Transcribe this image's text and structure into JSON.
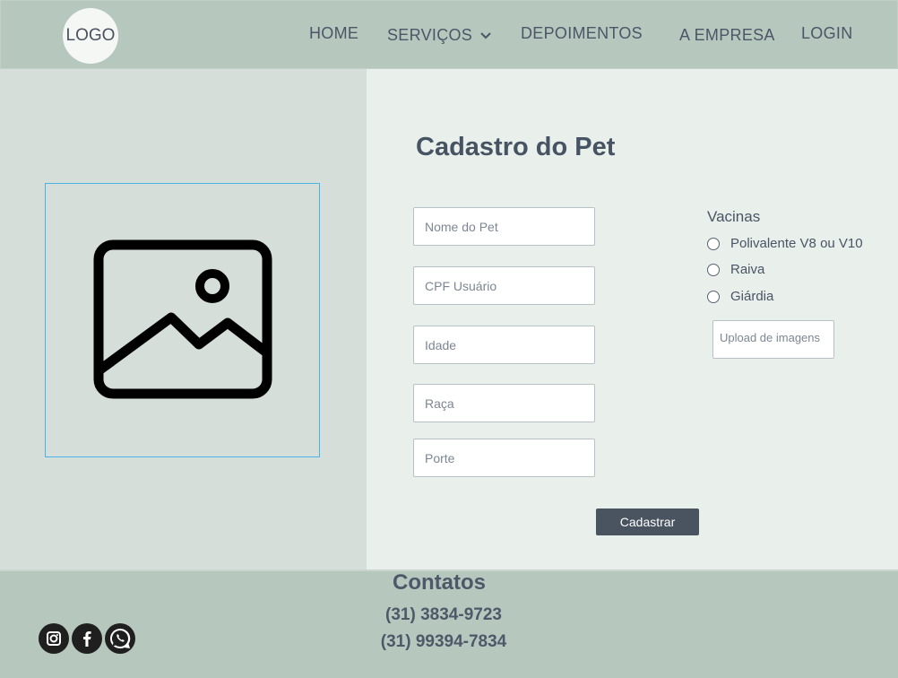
{
  "header": {
    "logo": "LOGO",
    "nav": {
      "home": "HOME",
      "servicos": "SERVIÇOS",
      "depoimentos": "DEPOIMENTOS",
      "empresa": "A EMPRESA",
      "login": "LOGIN"
    }
  },
  "form": {
    "title": "Cadastro do Pet",
    "fields": {
      "nome": "Nome do Pet",
      "cpf": "CPF Usuário",
      "idade": "Idade",
      "raca": "Raça",
      "porte": "Porte"
    },
    "vacinas": {
      "title": "Vacinas",
      "options": [
        "Polivalente V8 ou V10",
        "Raiva",
        "Giárdia"
      ]
    },
    "upload_label": "Upload de imagens",
    "submit_label": "Cadastrar"
  },
  "footer": {
    "contact_title": "Contatos",
    "phones": [
      "(31) 3834-9723",
      "(31) 99394-7834"
    ],
    "social": [
      "instagram-icon",
      "facebook-icon",
      "whatsapp-icon"
    ]
  },
  "colors": {
    "header_bg": "#b6c7bd",
    "left_panel_bg": "#d5ded8",
    "right_panel_bg": "#e9efeb",
    "accent_text": "#465363",
    "button_bg": "#4a5360"
  }
}
